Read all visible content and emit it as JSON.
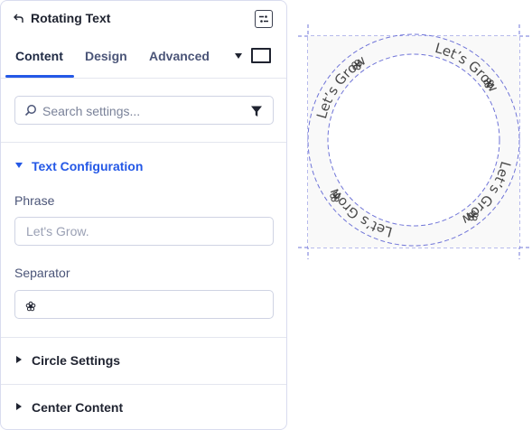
{
  "panel": {
    "header": {
      "title": "Rotating Text",
      "back_icon": "back-arrow-icon",
      "toggle_icon": "panel-toggle-icon"
    },
    "tabs": [
      {
        "label": "Content",
        "active": true
      },
      {
        "label": "Design",
        "active": false
      },
      {
        "label": "Advanced",
        "active": false
      }
    ],
    "search": {
      "placeholder": "Search settings...",
      "icon": "search-icon",
      "filter_icon": "filter-icon"
    },
    "text_configuration": {
      "title": "Text Configuration",
      "phrase": {
        "label": "Phrase",
        "placeholder": "Let's Grow."
      },
      "separator": {
        "label": "Separator",
        "value": "flower-icon"
      }
    },
    "sections": [
      {
        "title": "Circle Settings",
        "expanded": false
      },
      {
        "title": "Center Content",
        "expanded": false
      }
    ]
  },
  "preview": {
    "repeat_text": "Let’s Grow",
    "separator_icon": "flower-icon",
    "colors": {
      "guide": "#6f74d8",
      "text": "#4a4a4a",
      "accent": "#2458e6"
    }
  }
}
